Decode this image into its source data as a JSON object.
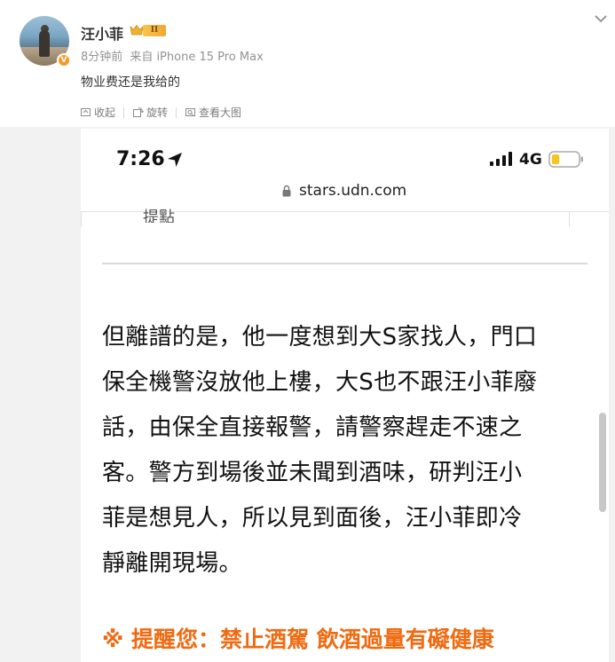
{
  "post": {
    "username": "汪小菲",
    "level_badge": "II",
    "verified_badge": "V",
    "meta": {
      "time": "8分钟前",
      "source_prefix": "来自",
      "device": "iPhone 15 Pro Max"
    },
    "text": "物业费还是我给的"
  },
  "toolbar": {
    "collapse_label": "收起",
    "repost_label": "旋转",
    "view_large_label": "查看大图"
  },
  "screenshot": {
    "status_time": "7:26",
    "network": "4G",
    "url": "stars.udn.com",
    "prev_text": "提點",
    "article_lines": [
      "但離譜的是，他一度想到大S家找人，門口",
      "保全機警沒放他上樓，大S也不跟汪小菲廢",
      "話，由保全直接報警，請警察趕走不速之",
      "客。警方到場後並未聞到酒味，研判汪小",
      "菲是想見人，所以見到面後，汪小菲即冷",
      "靜離開現場。"
    ],
    "warning": "※ 提醒您：禁止酒駕 飲酒過量有礙健康"
  },
  "colors": {
    "accent_orange": "#f06a10",
    "verified_orange": "#f59a23",
    "meta_gray": "#939393"
  }
}
